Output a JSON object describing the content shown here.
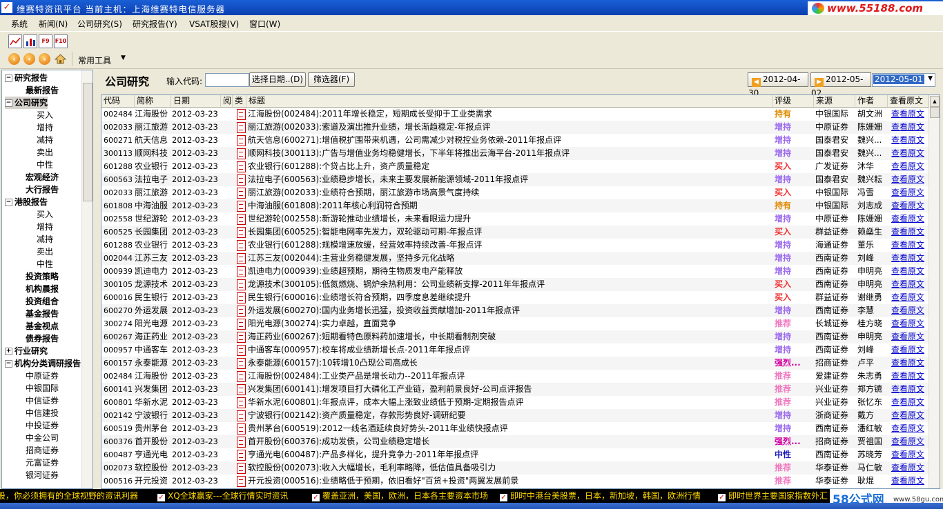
{
  "window": {
    "title": "维赛特资讯平台  当前主机：上海维赛特电信服务器",
    "logo_url": "www.55188.com"
  },
  "menu": [
    "系统",
    "新闻(N)",
    "公司研究(S)",
    "研究报告(Y)",
    "VSAT股搜(V)",
    "窗口(W)"
  ],
  "toolbar": {
    "chart_buttons": [
      "line-chart",
      "bar-chart",
      "F9",
      "F10"
    ],
    "common_tools_label": "常用工具"
  },
  "tree": [
    {
      "label": "研究报告",
      "level": 0,
      "bold": true,
      "toggle": "−"
    },
    {
      "label": "最新报告",
      "level": 1,
      "bold": true
    },
    {
      "label": "公司研究",
      "level": 1,
      "bold": true,
      "toggle": "−",
      "selected": true
    },
    {
      "label": "买入",
      "level": 2
    },
    {
      "label": "增持",
      "level": 2
    },
    {
      "label": "减持",
      "level": 2
    },
    {
      "label": "卖出",
      "level": 2
    },
    {
      "label": "中性",
      "level": 2
    },
    {
      "label": "宏观经济",
      "level": 1,
      "bold": true
    },
    {
      "label": "大行报告",
      "level": 1,
      "bold": true
    },
    {
      "label": "港股报告",
      "level": 1,
      "bold": true,
      "toggle": "−"
    },
    {
      "label": "买入",
      "level": 2
    },
    {
      "label": "增持",
      "level": 2
    },
    {
      "label": "减持",
      "level": 2
    },
    {
      "label": "卖出",
      "level": 2
    },
    {
      "label": "中性",
      "level": 2
    },
    {
      "label": "投资策略",
      "level": 1,
      "bold": true
    },
    {
      "label": "机构晨报",
      "level": 1,
      "bold": true
    },
    {
      "label": "投资组合",
      "level": 1,
      "bold": true
    },
    {
      "label": "基金报告",
      "level": 1,
      "bold": true
    },
    {
      "label": "基金视点",
      "level": 1,
      "bold": true
    },
    {
      "label": "债券报告",
      "level": 1,
      "bold": true
    },
    {
      "label": "行业研究",
      "level": 1,
      "bold": true,
      "toggle": "+"
    },
    {
      "label": "机构分类调研报告",
      "level": 0,
      "bold": true,
      "toggle": "−"
    },
    {
      "label": "中原证券",
      "level": 1
    },
    {
      "label": "中银国际",
      "level": 1
    },
    {
      "label": "中信证券",
      "level": 1
    },
    {
      "label": "中信建投",
      "level": 1
    },
    {
      "label": "中投证券",
      "level": 1
    },
    {
      "label": "中金公司",
      "level": 1
    },
    {
      "label": "招商证券",
      "level": 1
    },
    {
      "label": "元富证券",
      "level": 1
    },
    {
      "label": "银河证券",
      "level": 1
    }
  ],
  "panel": {
    "title": "公司研究",
    "code_label": "输入代码:",
    "code_value": "",
    "select_date_button": "选择日期..(D)",
    "filter_button": "筛选器(F)",
    "date_prev": "2012-04-30",
    "date_next": "2012-05-02",
    "date_current": "2012-05-01"
  },
  "columns": [
    "代码",
    "简称",
    "日期",
    "阅",
    "类",
    "标题",
    "评级",
    "来源",
    "作者",
    "查看原文"
  ],
  "rating_colors": {
    "持有": "#e08a00",
    "增持": "#9c6cf0",
    "买入": "#f03030",
    "推荐": "#f07ac0",
    "强烈...": "#d000a0",
    "中性": "#1a1ab8"
  },
  "rows": [
    {
      "code": "002484",
      "name": "江海股份",
      "date": "2012-03-23",
      "title": "江海股份(002484):2011年增长稳定，短期成长受抑于工业类需求",
      "rating": "持有",
      "source": "中银国际",
      "author": "胡文洲",
      "link": "查看原文"
    },
    {
      "code": "002033",
      "name": "丽江旅游",
      "date": "2012-03-23",
      "title": "丽江旅游(002033):索道及演出推升业绩，增长渐趋稳定-年报点评",
      "rating": "增持",
      "source": "中原证券",
      "author": "陈姗姗",
      "link": "查看原文"
    },
    {
      "code": "600271",
      "name": "航天信息",
      "date": "2012-03-23",
      "title": "航天信息(600271):增值税扩围带来机遇，公司需减少对税控业务依赖-2011年报点评",
      "rating": "增持",
      "source": "国泰君安",
      "author": "魏兴...",
      "link": "查看原文"
    },
    {
      "code": "300113",
      "name": "顺网科技",
      "date": "2012-03-23",
      "title": "顺网科技(300113):广告与增值业务均稳健增长，下半年将推出云海平台-2011年报点评",
      "rating": "增持",
      "source": "国泰君安",
      "author": "魏兴...",
      "link": "查看原文"
    },
    {
      "code": "601288",
      "name": "农业银行",
      "date": "2012-03-23",
      "title": "农业银行(601288):个贷占比上升，资产质量稳定",
      "rating": "买入",
      "source": "广发证券",
      "author": "沐华",
      "link": "查看原文"
    },
    {
      "code": "600563",
      "name": "法拉电子",
      "date": "2012-03-23",
      "title": "法拉电子(600563):业绩稳步增长，未来主要发展新能源领域-2011年报点评",
      "rating": "增持",
      "source": "国泰君安",
      "author": "魏兴耘",
      "link": "查看原文"
    },
    {
      "code": "002033",
      "name": "丽江旅游",
      "date": "2012-03-23",
      "title": "丽江旅游(002033):业绩符合预期，丽江旅游市场高景气度持续",
      "rating": "买入",
      "source": "中银国际",
      "author": "冯雪",
      "link": "查看原文"
    },
    {
      "code": "601808",
      "name": "中海油服",
      "date": "2012-03-23",
      "title": "中海油服(601808):2011年核心利润符合预期",
      "rating": "持有",
      "source": "中银国际",
      "author": "刘志成",
      "link": "查看原文"
    },
    {
      "code": "002558",
      "name": "世纪游轮",
      "date": "2012-03-23",
      "title": "世纪游轮(002558):新游轮推动业绩增长，未来看眼运力提升",
      "rating": "增持",
      "source": "中原证券",
      "author": "陈姗姗",
      "link": "查看原文"
    },
    {
      "code": "600525",
      "name": "长园集团",
      "date": "2012-03-23",
      "title": "长园集团(600525):智能电网率先发力，双轮驱动可期-年报点评",
      "rating": "买入",
      "source": "群益证券",
      "author": "赖燊生",
      "link": "查看原文"
    },
    {
      "code": "601288",
      "name": "农业银行",
      "date": "2012-03-23",
      "title": "农业银行(601288):规模增速放缓，经营效率持续改善-年报点评",
      "rating": "增持",
      "source": "海通证券",
      "author": "董乐",
      "link": "查看原文"
    },
    {
      "code": "002044",
      "name": "江苏三友",
      "date": "2012-03-23",
      "title": "江苏三友(002044):主营业务稳健发展，坚持多元化战略",
      "rating": "增持",
      "source": "西南证券",
      "author": "刘峰",
      "link": "查看原文"
    },
    {
      "code": "000939",
      "name": "凯迪电力",
      "date": "2012-03-23",
      "title": "凯迪电力(000939):业绩超预期，期待生物质发电产能释放",
      "rating": "增持",
      "source": "西南证券",
      "author": "申明亮",
      "link": "查看原文"
    },
    {
      "code": "300105",
      "name": "龙源技术",
      "date": "2012-03-23",
      "title": "龙源技术(300105):低氮燃烧、锅炉余热利用：公司业绩新支撑-2011年年报点评",
      "rating": "买入",
      "source": "西南证券",
      "author": "申明亮",
      "link": "查看原文"
    },
    {
      "code": "600016",
      "name": "民生银行",
      "date": "2012-03-23",
      "title": "民生银行(600016):业绩增长符合预期，四季度息差继续提升",
      "rating": "买入",
      "source": "群益证券",
      "author": "谢继勇",
      "link": "查看原文"
    },
    {
      "code": "600270",
      "name": "外运发展",
      "date": "2012-03-23",
      "title": "外运发展(600270):国内业务增长迅猛，投资收益贡献增加-2011年报点评",
      "rating": "增持",
      "source": "西南证券",
      "author": "李慧",
      "link": "查看原文"
    },
    {
      "code": "300274",
      "name": "阳光电源",
      "date": "2012-03-23",
      "title": "阳光电源(300274):实力卓越，直面竞争",
      "rating": "推荐",
      "source": "长城证券",
      "author": "桂方晓",
      "link": "查看原文"
    },
    {
      "code": "600267",
      "name": "海正药业",
      "date": "2012-03-23",
      "title": "海正药业(600267):短期看特色原料药加速增长，中长期看制剂突破",
      "rating": "增持",
      "source": "西南证券",
      "author": "申明亮",
      "link": "查看原文"
    },
    {
      "code": "000957",
      "name": "中通客车",
      "date": "2012-03-23",
      "title": "中通客车(000957):校车将成业绩新增长点-2011年年报点评",
      "rating": "增持",
      "source": "西南证券",
      "author": "刘峰",
      "link": "查看原文"
    },
    {
      "code": "600157",
      "name": "永泰能源",
      "date": "2012-03-23",
      "title": "永泰能源(600157):10转增10凸现公司高成长",
      "rating": "强烈...",
      "source": "招商证券",
      "author": "卢平",
      "link": "查看原文"
    },
    {
      "code": "002484",
      "name": "江海股份",
      "date": "2012-03-23",
      "title": "江海股份(002484):工业类产品是增长动力--2011年报点评",
      "rating": "推荐",
      "source": "爱建证券",
      "author": "朱志勇",
      "link": "查看原文"
    },
    {
      "code": "600141",
      "name": "兴发集团",
      "date": "2012-03-23",
      "title": "兴发集团(600141):增发项目打大磷化工产业链，盈利前景良好-公司点评报告",
      "rating": "推荐",
      "source": "兴业证券",
      "author": "郑方镳",
      "link": "查看原文"
    },
    {
      "code": "600801",
      "name": "华新水泥",
      "date": "2012-03-23",
      "title": "华新水泥(600801):年报点评，成本大幅上涨致业绩低于预期-定期报告点评",
      "rating": "推荐",
      "source": "兴业证券",
      "author": "张忆东",
      "link": "查看原文"
    },
    {
      "code": "002142",
      "name": "宁波银行",
      "date": "2012-03-23",
      "title": "宁波银行(002142):资产质量稳定，存款形势良好-调研纪要",
      "rating": "增持",
      "source": "浙商证券",
      "author": "戴方",
      "link": "查看原文"
    },
    {
      "code": "600519",
      "name": "贵州茅台",
      "date": "2012-03-23",
      "title": "贵州茅台(600519):2012一线名酒延续良好势头-2011年业绩快报点评",
      "rating": "增持",
      "source": "西南证券",
      "author": "潘红敏",
      "link": "查看原文"
    },
    {
      "code": "600376",
      "name": "首开股份",
      "date": "2012-03-23",
      "title": "首开股份(600376):成功发债，公司业绩稳定增长",
      "rating": "强烈...",
      "source": "招商证券",
      "author": "贾祖国",
      "link": "查看原文"
    },
    {
      "code": "600487",
      "name": "亨通光电",
      "date": "2012-03-23",
      "title": "亨通光电(600487):产品多样化，提升竞争力-2011年年报点评",
      "rating": "中性",
      "source": "西南证券",
      "author": "苏晓芳",
      "link": "查看原文"
    },
    {
      "code": "002073",
      "name": "软控股份",
      "date": "2012-03-23",
      "title": "软控股份(002073):收入大幅增长，毛利率略降，低估值具备吸引力",
      "rating": "推荐",
      "source": "华泰证券",
      "author": "马仁敏",
      "link": "查看原文"
    },
    {
      "code": "000516",
      "name": "开元投资",
      "date": "2012-03-23",
      "title": "开元投资(000516):业绩略低于预期，依旧看好\"百货+投资\"两翼发展前景",
      "rating": "推荐",
      "source": "华泰证券",
      "author": "耿焜",
      "link": "查看原文"
    }
  ],
  "ticker": [
    "股，你必须拥有的全球视野的资讯利器",
    "XQ全球赢家---全球行情实时资讯",
    "覆盖亚洲，美国，欧洲，日本各主要资本市场",
    "即时中港台美股票，日本，新加坡，韩国，欧洲行情",
    "即时世界主要国家指数外汇"
  ],
  "watermark": {
    "text": "58公式网",
    "url": "www.58gu.com"
  }
}
